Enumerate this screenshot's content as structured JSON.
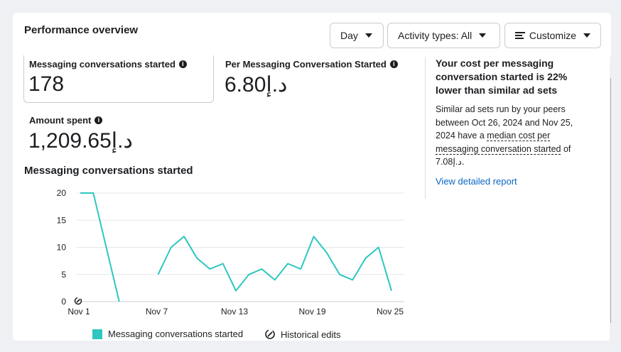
{
  "header": {
    "title": "Performance overview"
  },
  "toolbar": {
    "day_label": "Day",
    "activity_label": "Activity types: All",
    "customize_label": "Customize"
  },
  "metrics": {
    "conversations_label": "Messaging conversations started",
    "conversations_value": "178",
    "cost_label": "Per Messaging Conversation Started",
    "cost_value": "د.إ6.80",
    "spent_label": "Amount spent",
    "spent_value": "د.إ1,209.65"
  },
  "chart_title": "Messaging conversations started",
  "insight": {
    "headline": "Your cost per messaging conversation started is 22% lower than similar ad sets",
    "body_prefix": "Similar ad sets run by your peers between Oct 26, 2024 and Nov 25, 2024 have a ",
    "body_term": "median cost per messaging conversation started",
    "body_suffix": " of د.إ7.08.",
    "link": "View detailed report"
  },
  "legend": {
    "series": "Messaging conversations started",
    "edits": "Historical edits"
  },
  "icons": {
    "info": "info-icon",
    "customize": "customize-icon",
    "dropdown": "caret-down-icon",
    "historical_edit": "historical-edit-icon"
  },
  "colors": {
    "series": "#2ec7c0",
    "link": "#0a66c2"
  },
  "chart_data": {
    "type": "line",
    "x_ticks": [
      "Nov 1",
      "Nov 7",
      "Nov 13",
      "Nov 19",
      "Nov 25"
    ],
    "y_ticks": [
      0,
      5,
      10,
      15,
      20
    ],
    "ylim": [
      0,
      20
    ],
    "xlim": [
      1,
      25
    ],
    "grid": true,
    "series": [
      {
        "name": "Messaging conversations started",
        "segments": [
          [
            [
              1,
              20
            ],
            [
              2,
              20
            ],
            [
              4,
              0
            ]
          ],
          [
            [
              7,
              5
            ],
            [
              8,
              10
            ],
            [
              9,
              12
            ],
            [
              10,
              8
            ],
            [
              11,
              6
            ],
            [
              12,
              7
            ],
            [
              13,
              2
            ],
            [
              14,
              5
            ],
            [
              15,
              6
            ],
            [
              16,
              4
            ],
            [
              17,
              7
            ],
            [
              18,
              6
            ],
            [
              19,
              12
            ],
            [
              20,
              9
            ],
            [
              21,
              5
            ],
            [
              22,
              4
            ],
            [
              23,
              8
            ],
            [
              24,
              10
            ],
            [
              25,
              2
            ]
          ]
        ]
      }
    ],
    "historical_edits": [
      1
    ]
  }
}
